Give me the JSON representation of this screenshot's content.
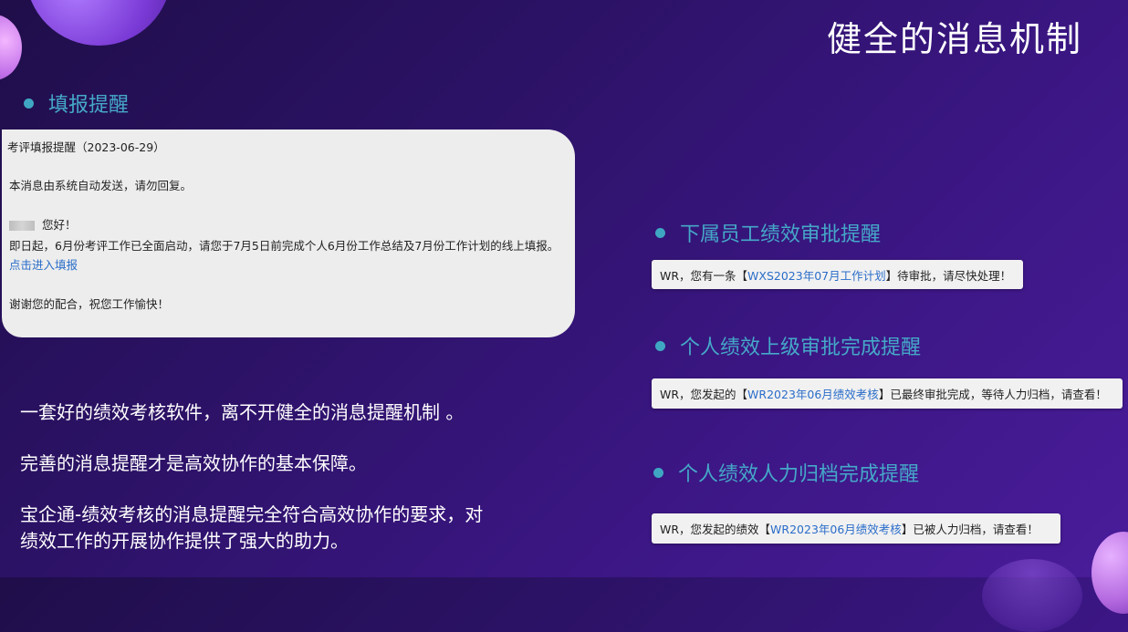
{
  "title": "健全的消息机制",
  "sections": {
    "fill_reminder": "填报提醒",
    "subordinate_approval": "下属员工绩效审批提醒",
    "superior_approval_done": "个人绩效上级审批完成提醒",
    "hr_archive_done": "个人绩效人力归档完成提醒"
  },
  "mail": {
    "subject": "考评填报提醒（2023-06-29）",
    "auto_notice": "本消息由系统自动发送，请勿回复。",
    "greeting": "您好！",
    "body": "即日起，6月份考评工作已全面启动，请您于7月5日前完成个人6月份工作总结及7月份工作计划的线上填报。",
    "link": "点击进入填报",
    "closing": "谢谢您的配合，祝您工作愉快！"
  },
  "description": {
    "line1": "一套好的绩效考核软件，离不开健全的消息提醒机制 。",
    "line2": "完善的消息提醒才是高效协作的基本保障。",
    "line3a": "宝企通-绩效考核的消息提醒完全符合高效协作的要求，对",
    "line3b": "绩效工作的开展协作提供了强大的助力。"
  },
  "notices": {
    "n1": {
      "pre": "WR，您有一条【",
      "link": "WXS2023年07月工作计划",
      "post": "】待审批，请尽快处理！"
    },
    "n2": {
      "pre": "WR，您发起的【",
      "link": "WR2023年06月绩效考核",
      "post": "】已最终审批完成，等待人力归档，请查看！"
    },
    "n3": {
      "pre": "WR，您发起的绩效【",
      "link": "WR2023年06月绩效考核",
      "post": "】已被人力归档，请查看！"
    }
  },
  "colors": {
    "accent": "#45a8c8",
    "link": "#2a6dc9"
  }
}
